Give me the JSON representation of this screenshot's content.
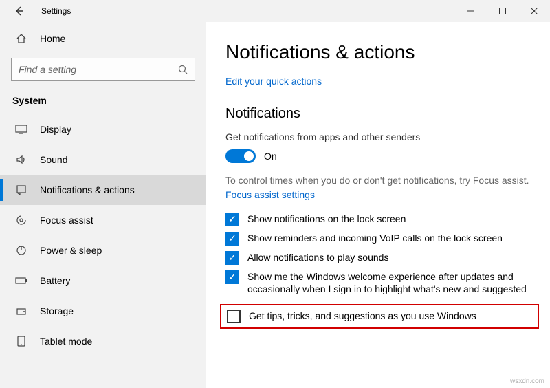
{
  "window": {
    "title": "Settings"
  },
  "sidebar": {
    "home": "Home",
    "search_placeholder": "Find a setting",
    "category": "System",
    "items": [
      {
        "label": "Display",
        "icon": "display"
      },
      {
        "label": "Sound",
        "icon": "sound"
      },
      {
        "label": "Notifications & actions",
        "icon": "notifications",
        "active": true
      },
      {
        "label": "Focus assist",
        "icon": "focus"
      },
      {
        "label": "Power & sleep",
        "icon": "power"
      },
      {
        "label": "Battery",
        "icon": "battery"
      },
      {
        "label": "Storage",
        "icon": "storage"
      },
      {
        "label": "Tablet mode",
        "icon": "tablet"
      }
    ]
  },
  "content": {
    "heading": "Notifications & actions",
    "quick_link": "Edit your quick actions",
    "section_heading": "Notifications",
    "notif_desc": "Get notifications from apps and other senders",
    "toggle_label": "On",
    "focus_text": "To control times when you do or don't get notifications, try Focus assist.",
    "focus_link": "Focus assist settings",
    "checks": [
      {
        "checked": true,
        "label": "Show notifications on the lock screen"
      },
      {
        "checked": true,
        "label": "Show reminders and incoming VoIP calls on the lock screen"
      },
      {
        "checked": true,
        "label": "Allow notifications to play sounds"
      },
      {
        "checked": true,
        "label": "Show me the Windows welcome experience after updates and occasionally when I sign in to highlight what's new and suggested"
      },
      {
        "checked": false,
        "label": "Get tips, tricks, and suggestions as you use Windows",
        "highlight": true
      }
    ]
  },
  "watermark": "wsxdn.com"
}
